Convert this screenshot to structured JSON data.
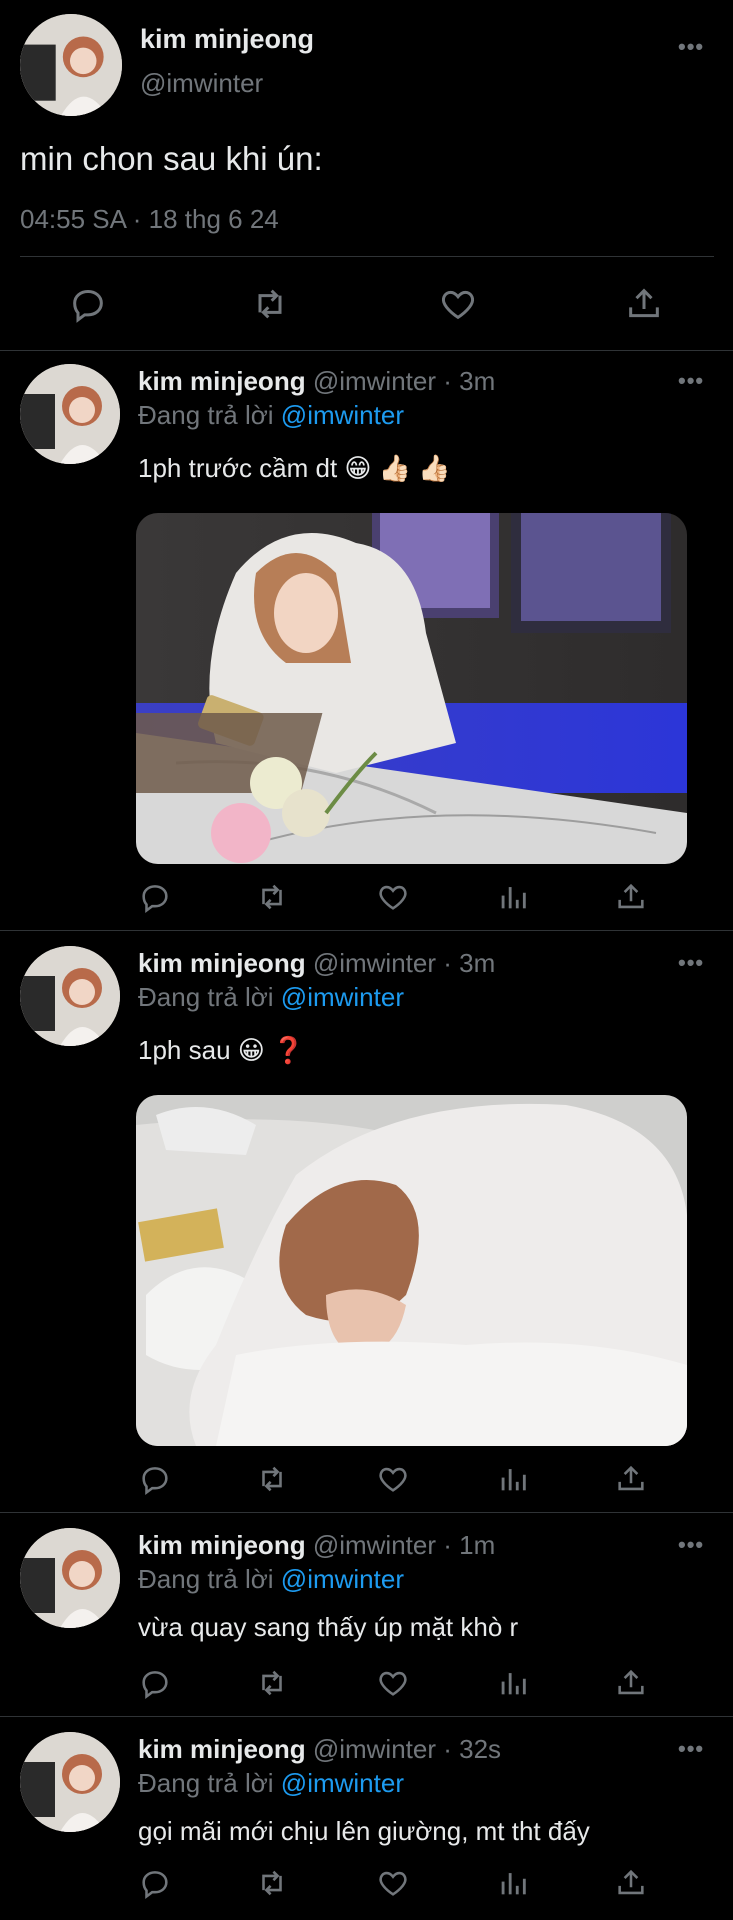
{
  "main_tweet": {
    "display_name": "kim minjeong",
    "handle": "@imwinter",
    "text": "min chon sau khi ún:",
    "timestamp": "04:55 SA · 18 thg 6 24",
    "actions": [
      "reply-icon",
      "retweet-icon",
      "like-icon",
      "share-icon"
    ]
  },
  "replies": [
    {
      "display_name": "kim minjeong",
      "handle": "@imwinter",
      "sep": "·",
      "time": "3m",
      "reply_prefix": "Đang trả lời",
      "reply_to": "@imwinter",
      "text": "1ph trước cầm dt 😁 👍🏻 👍🏻",
      "media": "photo of person in white hoodie looking at phone at marble table"
    },
    {
      "display_name": "kim minjeong",
      "handle": "@imwinter",
      "sep": "·",
      "time": "3m",
      "reply_prefix": "Đang trả lời",
      "reply_to": "@imwinter",
      "text": "1ph sau 😀 ❓",
      "media": "photo of person in white hoodie resting head on table"
    },
    {
      "display_name": "kim minjeong",
      "handle": "@imwinter",
      "sep": "·",
      "time": "1m",
      "reply_prefix": "Đang trả lời",
      "reply_to": "@imwinter",
      "text": "vừa quay sang thấy úp mặt khò r"
    },
    {
      "display_name": "kim minjeong",
      "handle": "@imwinter",
      "sep": "·",
      "time": "32s",
      "reply_prefix": "Đang trả lời",
      "reply_to": "@imwinter",
      "text": "gọi mãi mới chịu lên giường, mt tht đấy"
    }
  ],
  "more_label": "•••",
  "colors": {
    "background": "#000000",
    "text": "#e7e9ea",
    "muted": "#71767b",
    "link": "#1d9bf0",
    "divider": "#2f3336"
  },
  "photo_alt": {
    "photo1": "Anh ban dau",
    "photo2": "Anh sau"
  }
}
